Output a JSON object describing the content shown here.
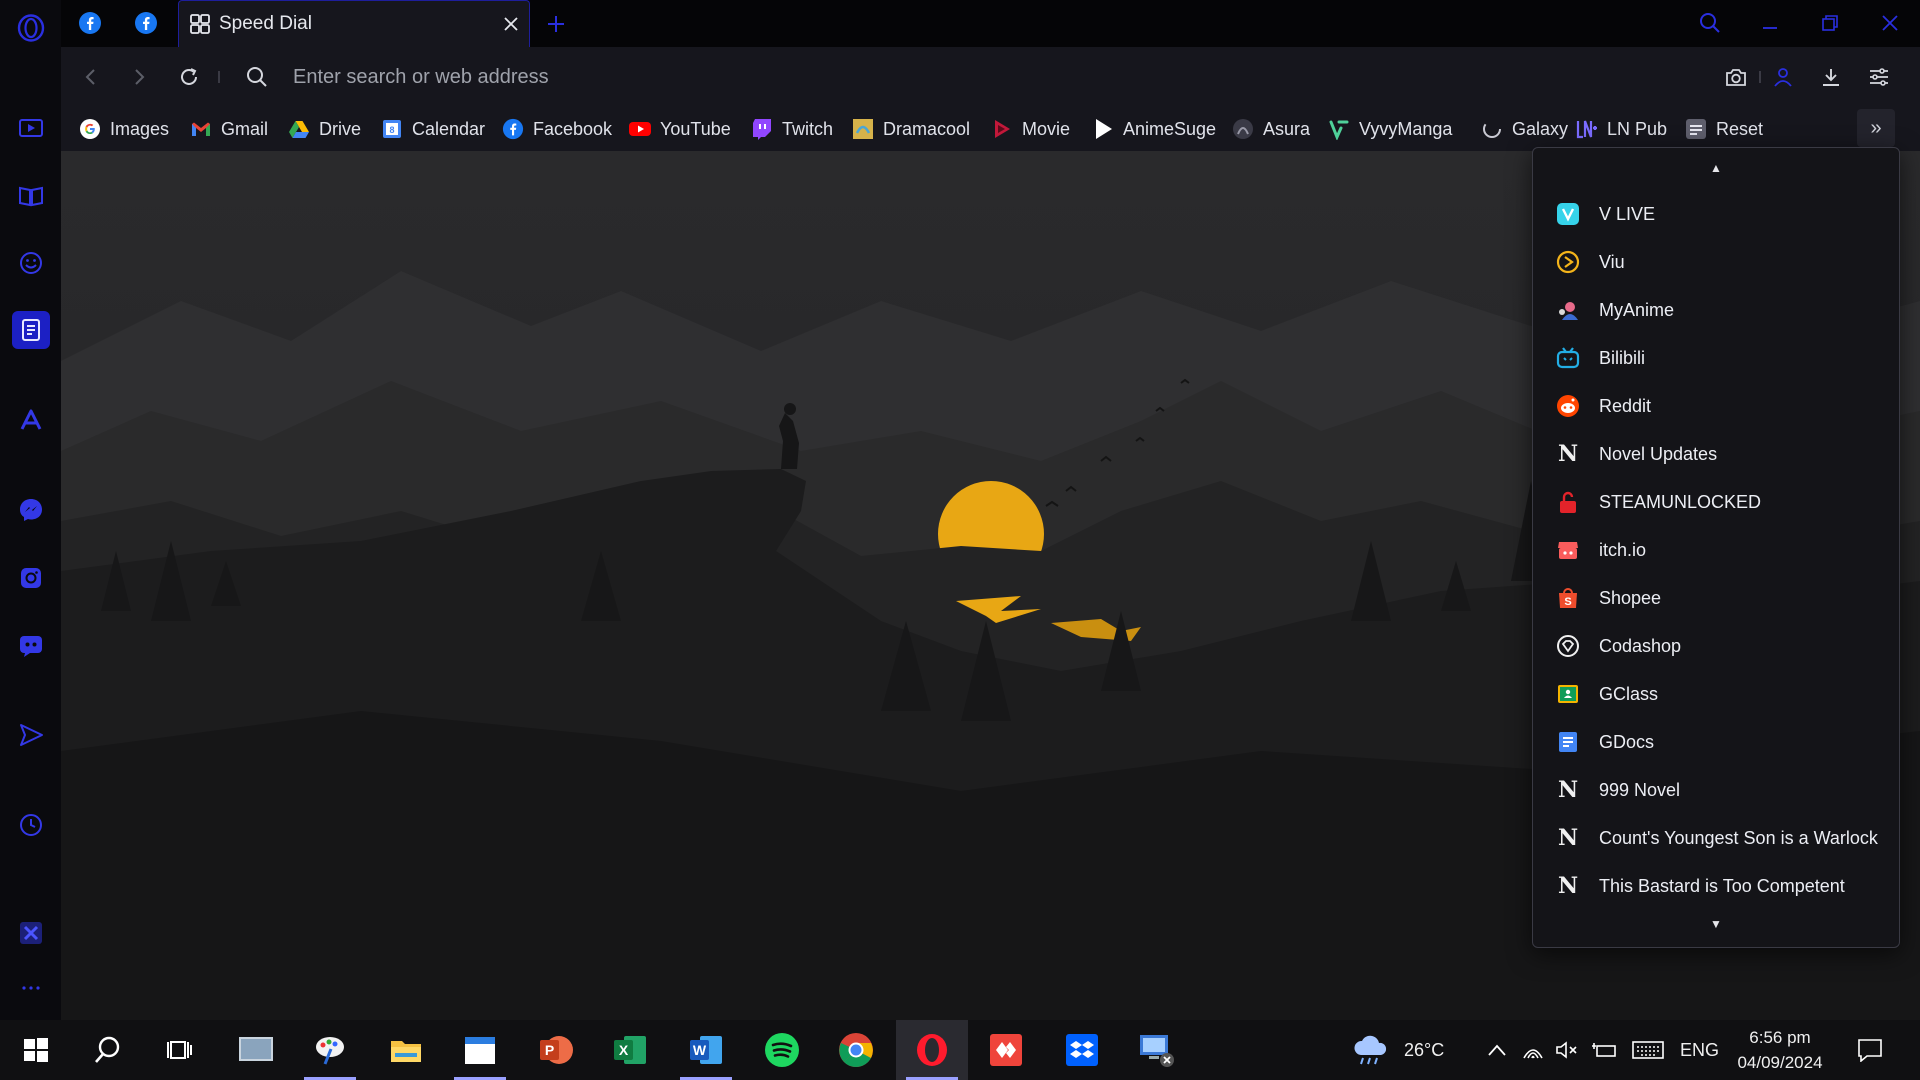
{
  "tabs": {
    "pinned": [
      {
        "name": "facebook-pinned-tab-1"
      },
      {
        "name": "facebook-pinned-tab-2"
      }
    ],
    "active": {
      "title": "Speed Dial"
    }
  },
  "address_bar": {
    "placeholder": "Enter search or web address"
  },
  "bookmarks": [
    {
      "label": "Images",
      "icon": "google-icon"
    },
    {
      "label": "Gmail",
      "icon": "gmail-icon"
    },
    {
      "label": "Drive",
      "icon": "drive-icon"
    },
    {
      "label": "Calendar",
      "icon": "calendar-icon"
    },
    {
      "label": "Facebook",
      "icon": "facebook-icon"
    },
    {
      "label": "YouTube",
      "icon": "youtube-icon"
    },
    {
      "label": "Twitch",
      "icon": "twitch-icon"
    },
    {
      "label": "Dramacool",
      "icon": "dramacool-icon"
    },
    {
      "label": "Movie",
      "icon": "movie-icon"
    },
    {
      "label": "AnimeSuge",
      "icon": "animesuge-icon"
    },
    {
      "label": "Asura",
      "icon": "asura-icon"
    },
    {
      "label": "VyvyManga",
      "icon": "vyvymanga-icon"
    },
    {
      "label": "Galaxy",
      "icon": "galaxy-icon"
    },
    {
      "label": "LN Pub",
      "icon": "lnpub-icon"
    },
    {
      "label": "Reset",
      "icon": "reset-icon"
    }
  ],
  "bookmark_menu": {
    "items": [
      {
        "label": "V LIVE",
        "icon": "vlive-icon"
      },
      {
        "label": "Viu",
        "icon": "viu-icon"
      },
      {
        "label": "MyAnime",
        "icon": "myanime-icon"
      },
      {
        "label": "Bilibili",
        "icon": "bilibili-icon"
      },
      {
        "label": "Reddit",
        "icon": "reddit-icon"
      },
      {
        "label": "Novel Updates",
        "icon": "novel-updates-icon"
      },
      {
        "label": "STEAMUNLOCKED",
        "icon": "steamunlocked-icon"
      },
      {
        "label": "itch.io",
        "icon": "itchio-icon"
      },
      {
        "label": "Shopee",
        "icon": "shopee-icon"
      },
      {
        "label": "Codashop",
        "icon": "codashop-icon"
      },
      {
        "label": "GClass",
        "icon": "gclass-icon"
      },
      {
        "label": "GDocs",
        "icon": "gdocs-icon"
      },
      {
        "label": "999 Novel",
        "icon": "novel-n-icon"
      },
      {
        "label": "Count's Youngest Son is a Warlock",
        "icon": "novel-n-icon"
      },
      {
        "label": "This Bastard is Too Competent",
        "icon": "novel-n-icon"
      }
    ]
  },
  "taskbar": {
    "weather": {
      "temperature": "26°C",
      "icon": "cloud-rain-icon"
    },
    "language": "ENG",
    "time": "6:56 pm",
    "date": "04/09/2024"
  },
  "colors": {
    "accent": "#2a2fe0",
    "sidebar_icon": "#3338e6",
    "toolbar_bg": "#16161d",
    "tab_strip_bg": "#050507",
    "sun": "#e8a714"
  }
}
